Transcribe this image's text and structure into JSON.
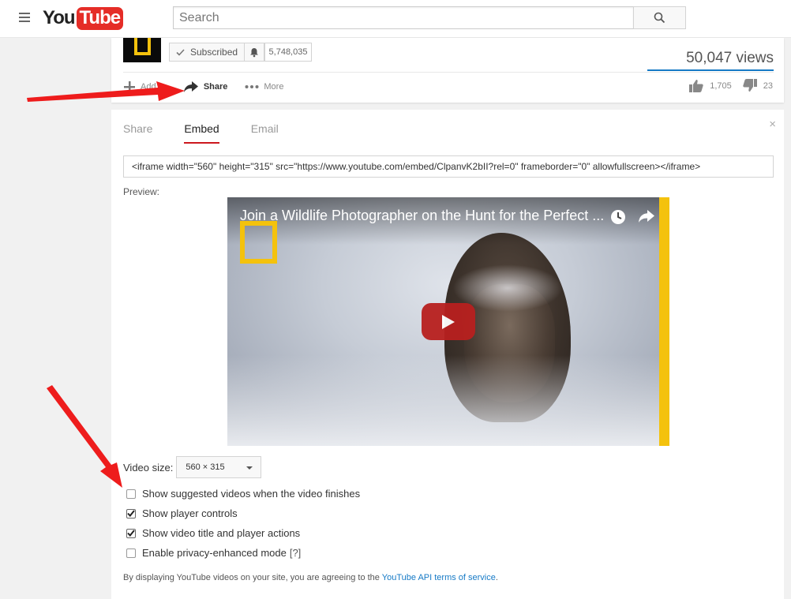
{
  "masthead": {
    "logo_you": "You",
    "logo_tube": "Tube",
    "search_placeholder": "Search"
  },
  "video": {
    "subscribe_label": "Subscribed",
    "subscriber_count": "5,748,035",
    "views": "50,047 views",
    "actions": {
      "add_to": "Add to",
      "share": "Share",
      "more": "More"
    },
    "likes": "1,705",
    "dislikes": "23"
  },
  "share_panel": {
    "tabs": [
      "Share",
      "Embed",
      "Email"
    ],
    "active_tab": "Embed",
    "close_symbol": "×",
    "embed_code": "<iframe width=\"560\" height=\"315\" src=\"https://www.youtube.com/embed/ClpanvK2bII?rel=0\" frameborder=\"0\" allowfullscreen></iframe>",
    "preview_label": "Preview:",
    "player_title": "Join a Wildlife Photographer on the Hunt for the Perfect ...",
    "video_size_label": "Video size:",
    "video_size_value": "560 × 315",
    "options": [
      {
        "label": "Show suggested videos when the video finishes",
        "checked": false
      },
      {
        "label": "Show player controls",
        "checked": true
      },
      {
        "label": "Show video title and player actions",
        "checked": true
      },
      {
        "label": "Enable privacy-enhanced mode",
        "checked": false,
        "help": "[?]"
      }
    ],
    "terms_text": "By displaying YouTube videos on your site, you are agreeing to the",
    "terms_link": "YouTube API terms of service",
    "terms_end": "."
  },
  "colors": {
    "brand_red": "#e52d27",
    "link_blue": "#167ac6",
    "tab_underline": "#cc181e",
    "annotation_arrow": "#ee1c1c",
    "natgeo_yellow": "#f4c20d"
  }
}
